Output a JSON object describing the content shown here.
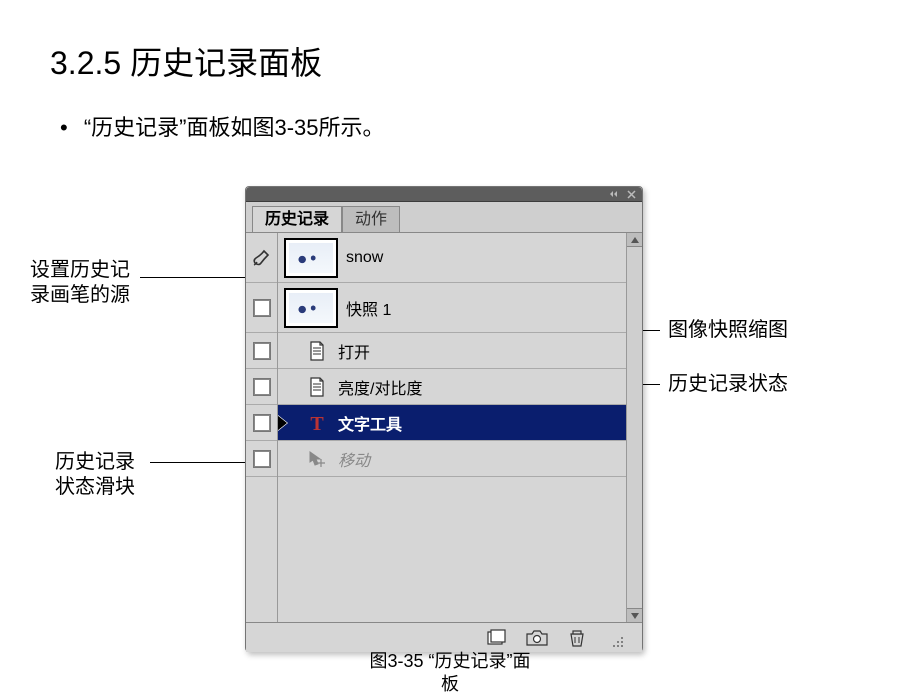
{
  "heading": "3.2.5  历史记录面板",
  "bullet": "“历史记录”面板如图3-35所示。",
  "panel": {
    "tabs": {
      "history": "历史记录",
      "actions": "动作"
    },
    "snapshots": [
      {
        "label": "snow"
      },
      {
        "label": "快照 1"
      }
    ],
    "history": [
      {
        "icon": "doc",
        "label": "打开",
        "selected": false,
        "faded": false
      },
      {
        "icon": "doc",
        "label": "亮度/对比度",
        "selected": false,
        "faded": false
      },
      {
        "icon": "text",
        "label": "文字工具",
        "selected": true,
        "faded": false
      },
      {
        "icon": "move",
        "label": "移动",
        "selected": false,
        "faded": true
      }
    ]
  },
  "annotations": {
    "brushSource": "设置历史记\n录画笔的源",
    "slider": "历史记录\n状态滑块",
    "snapshotThumb": "图像快照缩图",
    "historyState": "历史记录状态"
  },
  "caption": "图3-35 “历史记录”面\n板"
}
